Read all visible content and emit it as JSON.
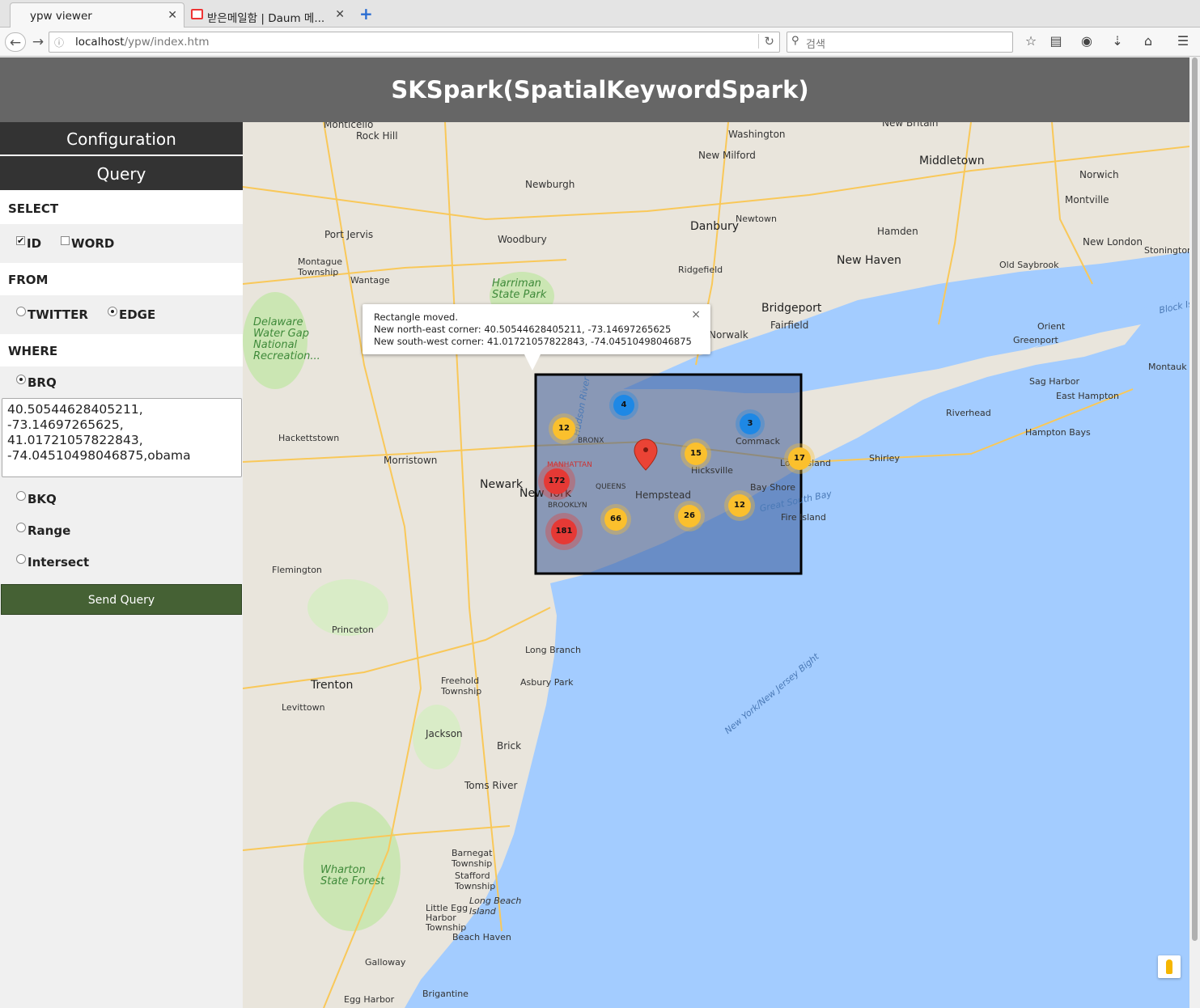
{
  "browser": {
    "tabs": [
      {
        "title": "ypw viewer",
        "close": "✕"
      },
      {
        "title": "받은메일함 | Daum 메...",
        "close": "✕"
      }
    ],
    "new_tab": "+",
    "url_host": "localhost",
    "url_path": "/ypw/index.htm",
    "search_placeholder": "검색"
  },
  "app": {
    "title": "SKSpark(SpatialKeywordSpark)"
  },
  "sidebar": {
    "configuration_label": "Configuration",
    "query_label": "Query",
    "select_title": "SELECT",
    "select_options": [
      {
        "label": "ID",
        "checked": true
      },
      {
        "label": "WORD",
        "checked": false
      }
    ],
    "from_title": "FROM",
    "from_options": [
      {
        "label": "TWITTER",
        "checked": false
      },
      {
        "label": "EDGE",
        "checked": true
      }
    ],
    "where_title": "WHERE",
    "where_options": [
      {
        "label": "BRQ",
        "checked": true
      },
      {
        "label": "BKQ",
        "checked": false
      },
      {
        "label": "Range",
        "checked": false
      },
      {
        "label": "Intersect",
        "checked": false
      }
    ],
    "query_text": "40.50544628405211,\n-73.14697265625,\n41.01721057822843,\n-74.04510498046875,obama",
    "send_label": "Send Query"
  },
  "map": {
    "infowindow": {
      "title": "Rectangle moved.",
      "ne": "New north-east corner: 40.50544628405211, -73.14697265625",
      "sw": "New south-west corner: 41.01721057822843, -74.04510498046875",
      "close": "×"
    },
    "clusters": [
      "4",
      "12",
      "3",
      "15",
      "17",
      "172",
      "66",
      "26",
      "12",
      "181"
    ],
    "places": [
      "Monticello",
      "Rock Hill",
      "Washington",
      "New Milford",
      "New Britain",
      "Middletown",
      "Norwich",
      "Montville",
      "New London",
      "Stonington",
      "Newburgh",
      "Danbury",
      "Newtown",
      "Hamden",
      "New Haven",
      "Old Saybrook",
      "Port Jervis",
      "Woodbury",
      "Ridgefield",
      "Bridgeport",
      "Fairfield",
      "Norwalk",
      "Montague Township",
      "Wantage",
      "Harriman State Park",
      "Delaware Water Gap National Recreation...",
      "Orient",
      "Greenport",
      "Montauk",
      "Sag Harbor",
      "East Hampton",
      "Riverhead",
      "Hampton Bays",
      "Shirley",
      "Hackettstown",
      "Morristown",
      "Newark",
      "New York",
      "MANHATTAN",
      "BRONX",
      "QUEENS",
      "BROOKLYN",
      "Hempstead",
      "Hicksville",
      "Commack",
      "Bay Shore",
      "Long Island",
      "Fire Island",
      "Great South Bay",
      "Flemington",
      "Princeton",
      "Trenton",
      "Levittown",
      "Long Branch",
      "Asbury Park",
      "Freehold Township",
      "Jackson",
      "Brick",
      "Toms River",
      "Barnegat Township",
      "Stafford Township",
      "Wharton State Forest",
      "Long Beach Island",
      "Little Egg Harbor Township",
      "Beach Haven",
      "Galloway",
      "Brigantine",
      "Egg Harbor",
      "New York/New Jersey Bight",
      "Block Is",
      "Hudson River"
    ]
  },
  "colors": {
    "header_bg": "#666666",
    "sidebar_button_bg": "#333333",
    "send_button_bg": "#456134",
    "water": "#a3ccff",
    "land": "#e9e5dc",
    "cluster_blue": "#1e88e5",
    "cluster_yellow": "#fbc02d",
    "cluster_red": "#e53935"
  }
}
